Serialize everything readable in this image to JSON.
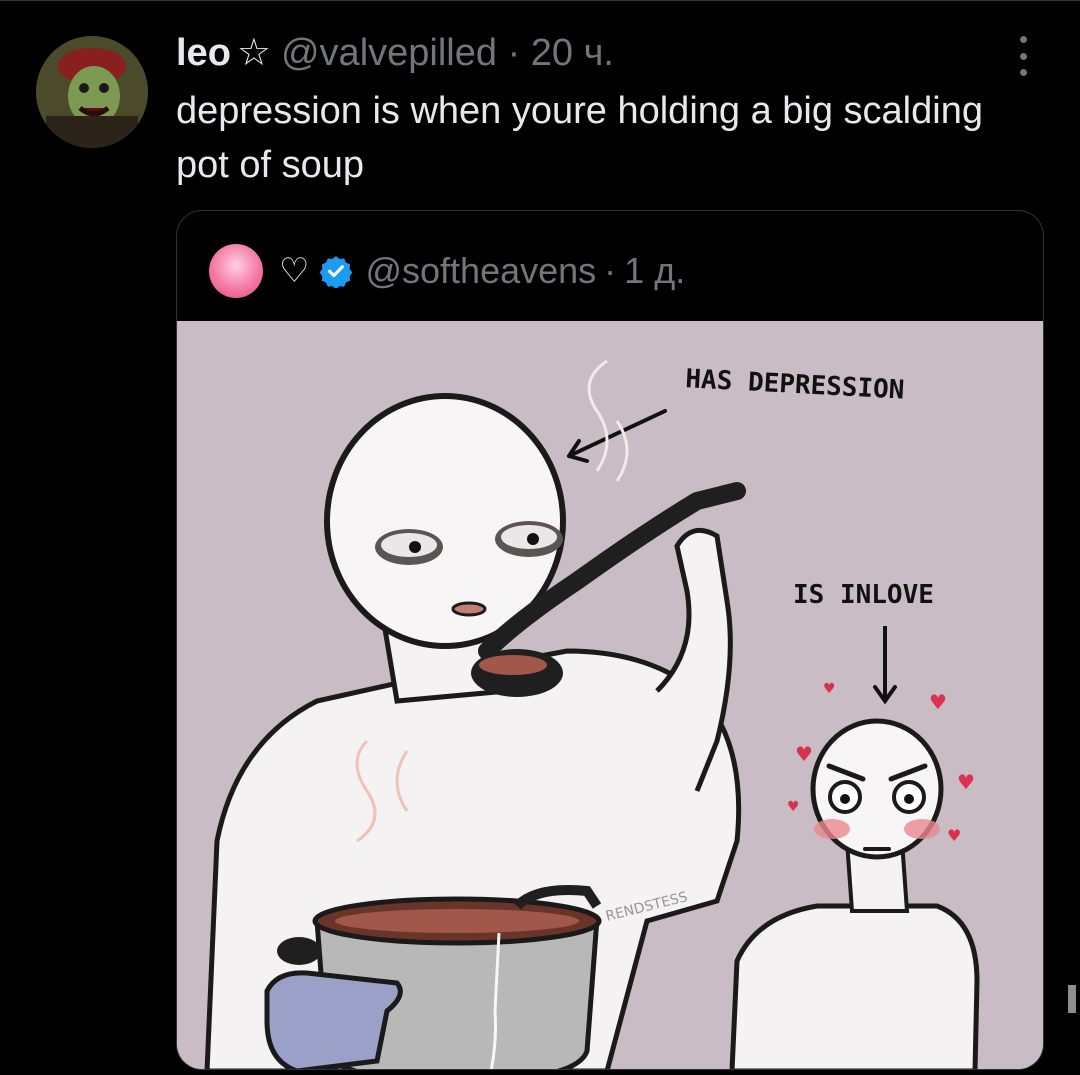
{
  "tweet": {
    "author_name": "leo",
    "star": "☆",
    "handle": "@valvepilled",
    "separator": "·",
    "time": "20 ч.",
    "text": "depression is when youre holding a big scalding pot of soup"
  },
  "quoted_tweet": {
    "heart": "♡",
    "verified": true,
    "handle": "@softheavens",
    "separator": "·",
    "time": "1 д.",
    "image_text": {
      "label_left": "HAS DEPRESSION",
      "label_right": "IS INLOVE",
      "watermark": "RENDSTESS"
    }
  },
  "icons": {
    "more": "more-options-icon",
    "verified": "verified-badge-icon"
  },
  "colors": {
    "background": "#000000",
    "text": "#e7e9ea",
    "muted": "#71767b",
    "verified": "#1d9bf0",
    "image_bg": "#c9bcc4"
  }
}
